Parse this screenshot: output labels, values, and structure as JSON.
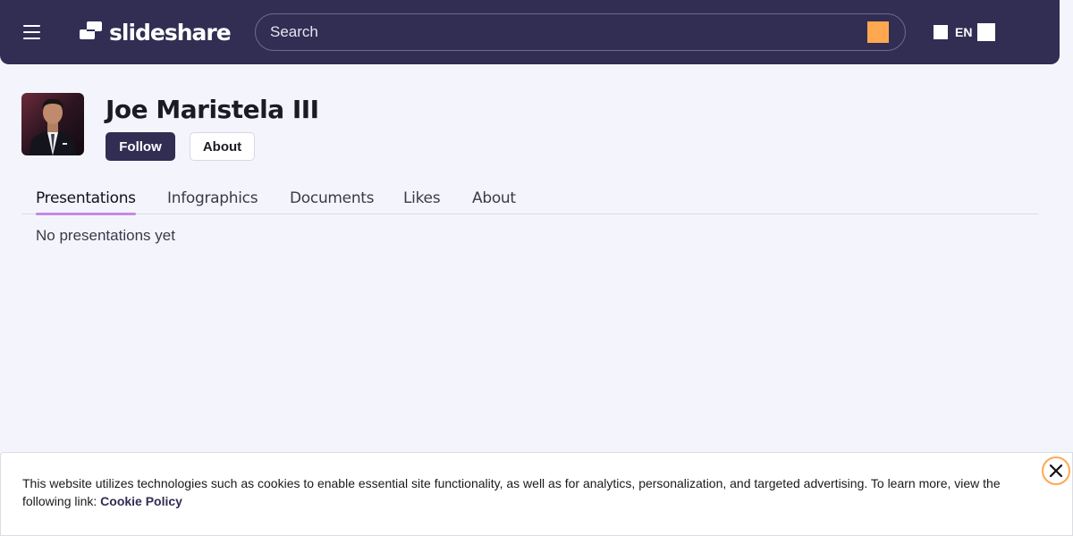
{
  "header": {
    "logo_text": "slideshare",
    "search": {
      "placeholder": "Search",
      "value": ""
    },
    "language": "EN",
    "colors": {
      "background": "#312d53",
      "accent": "#ffa84f"
    }
  },
  "profile": {
    "name": "Joe Maristela III",
    "follow_label": "Follow",
    "about_label": "About"
  },
  "tabs": [
    {
      "label": "Presentations",
      "active": true
    },
    {
      "label": "Infographics",
      "active": false
    },
    {
      "label": "Documents",
      "active": false
    },
    {
      "label": "Likes",
      "active": false
    },
    {
      "label": "About",
      "active": false
    }
  ],
  "content": {
    "empty_message": "No presentations yet"
  },
  "cookie_banner": {
    "text": "This website utilizes technologies such as cookies to enable essential site functionality, as well as for analytics, personalization, and targeted advertising. To learn more, view the following link: ",
    "link_label": "Cookie Policy",
    "close_icon": "close-icon"
  }
}
